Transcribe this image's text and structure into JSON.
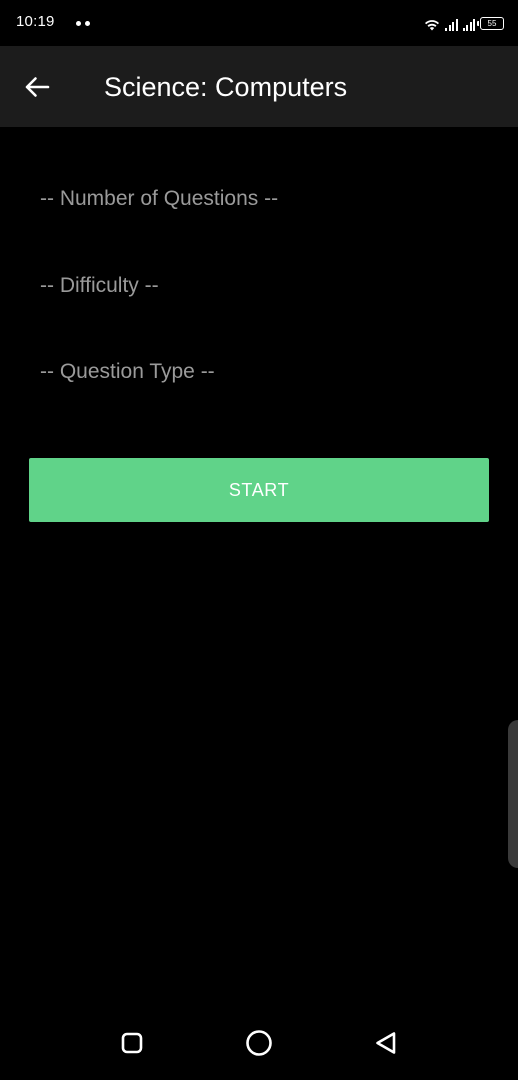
{
  "status_bar": {
    "time": "10:19",
    "battery": "55",
    "icons": [
      "wifi-icon",
      "signal-icon",
      "signal-icon",
      "battery-icon"
    ]
  },
  "app_bar": {
    "title": "Science: Computers",
    "back_icon": "arrow-left-icon"
  },
  "form": {
    "number_of_questions_placeholder": "-- Number of Questions --",
    "difficulty_placeholder": "-- Difficulty --",
    "question_type_placeholder": "-- Question Type --"
  },
  "start_button": {
    "label": "START"
  },
  "nav_bar": {
    "icons": [
      "recent-apps-icon",
      "home-icon",
      "back-triangle-icon"
    ]
  },
  "colors": {
    "background": "#000000",
    "app_bar": "#1c1c1c",
    "accent": "#60d389",
    "placeholder_text": "#9a9a9a"
  }
}
